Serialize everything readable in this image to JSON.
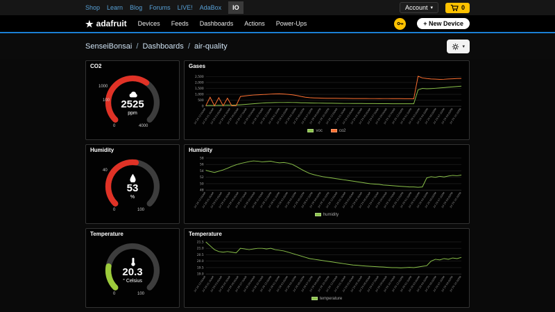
{
  "icons": {
    "star": "★",
    "caret_down": "▾"
  },
  "colors": {
    "accent_blue": "#1b7fd4",
    "brand_yellow": "#ffc200",
    "gauge_red": "#e03226",
    "gauge_green": "#9ccb3b",
    "line_green": "#8bc34a",
    "line_orange": "#ff7030",
    "track_gray": "#3d3d3d"
  },
  "topbar": {
    "links": [
      "Shop",
      "Learn",
      "Blog",
      "Forums",
      "LIVE!",
      "AdaBox"
    ],
    "io_badge": "IO",
    "account_label": "Account",
    "cart_count": "0"
  },
  "nav": {
    "brand": "adafruit",
    "items": [
      "Devices",
      "Feeds",
      "Dashboards",
      "Actions",
      "Power-Ups"
    ],
    "new_device_label": "+ New Device"
  },
  "breadcrumb": {
    "parts": [
      "SenseiBonsai",
      "Dashboards",
      "air-quality"
    ],
    "separator": "/"
  },
  "gauges": [
    {
      "key": "co2",
      "title": "CO2",
      "value": "2525",
      "unit": "ppm",
      "fraction": 0.63,
      "color": "#e03226",
      "track_color": "#3d3d3d",
      "icon": "cloud-icon",
      "shape": "cloud",
      "scale_labels": [
        {
          "text": "1000",
          "x": -3,
          "y": 20
        },
        {
          "text": "100",
          "x": 3,
          "y": 40
        },
        {
          "text": "0",
          "x": 18,
          "y": 77
        },
        {
          "text": "4000",
          "x": 55,
          "y": 77
        }
      ]
    },
    {
      "key": "humidity",
      "title": "Humidity",
      "value": "53",
      "unit": "%",
      "fraction": 0.53,
      "color": "#e03226",
      "track_color": "#3d3d3d",
      "icon": "droplet-icon",
      "shape": "drop",
      "scale_labels": [
        {
          "text": "40",
          "x": 3,
          "y": 20
        },
        {
          "text": "0",
          "x": 18,
          "y": 77
        },
        {
          "text": "100",
          "x": 53,
          "y": 77
        }
      ]
    },
    {
      "key": "temperature",
      "title": "Temperature",
      "value": "20.3",
      "unit": "° Celsius",
      "fraction": 0.203,
      "color": "#9ccb3b",
      "track_color": "#3d3d3d",
      "icon": "thermometer-icon",
      "shape": "therm",
      "scale_labels": [
        {
          "text": "0",
          "x": 18,
          "y": 77
        },
        {
          "text": "100",
          "x": 53,
          "y": 77
        }
      ]
    }
  ],
  "chart_data": {
    "x_ticks": [
      "Jul 28 12:00AM",
      "Jul 28 01:30AM",
      "Jul 28 03:00AM",
      "Jul 28 04:30AM",
      "Jul 28 06:00AM",
      "Jul 28 07:30AM",
      "Jul 28 09:00AM",
      "Jul 28 10:30AM",
      "Jul 28 12:00PM",
      "Jul 28 01:30PM",
      "Jul 28 03:00PM",
      "Jul 28 04:30PM",
      "Jul 28 06:00PM",
      "Jul 28 07:30PM",
      "Jul 28 09:00PM",
      "Jul 28 10:30PM",
      "Jul 29 12:00AM",
      "Jul 29 01:30AM",
      "Jul 29 03:00AM",
      "Jul 29 04:30AM",
      "Jul 29 06:00AM",
      "Jul 29 07:30AM",
      "Jul 29 09:00AM",
      "Jul 29 10:30AM",
      "Jul 29 12:00PM",
      "Jul 29 01:30PM",
      "Jul 29 03:00PM",
      "Jul 29 04:30PM",
      "Jul 29 06:00PM",
      "Jul 29 07:30PM",
      "Jul 29 09:00PM",
      "Jul 29 10:30PM"
    ],
    "charts": [
      {
        "key": "gases",
        "title": "Gases",
        "type": "line",
        "ylim": [
          0,
          2700
        ],
        "grid": true,
        "legend_position": "bottom",
        "yticks": [
          {
            "v": 0,
            "label": "0"
          },
          {
            "v": 500,
            "label": "500"
          },
          {
            "v": 1000,
            "label": "1,000"
          },
          {
            "v": 1500,
            "label": "1,500"
          },
          {
            "v": 2000,
            "label": "2,000"
          },
          {
            "v": 2500,
            "label": "2,500"
          }
        ],
        "series": [
          {
            "name": "voc",
            "color": "#8bc34a",
            "values": [
              50,
              70,
              60,
              80,
              70,
              90,
              85,
              95,
              120,
              150,
              180,
              210,
              240,
              265,
              285,
              300,
              310,
              315,
              318,
              320,
              315,
              310,
              295,
              285,
              275,
              268,
              262,
              258,
              254,
              250,
              246,
              242,
              238,
              235,
              232,
              230,
              228,
              226,
              224,
              222,
              220,
              218,
              216,
              214,
              212,
              210,
              208,
              206,
              205,
              1380,
              1500,
              1470,
              1490,
              1510,
              1540,
              1570,
              1600,
              1630,
              1660,
              1690
            ]
          },
          {
            "name": "co2",
            "color": "#ff7030",
            "values": [
              40,
              760,
              40,
              720,
              40,
              680,
              40,
              60,
              820,
              870,
              910,
              940,
              960,
              980,
              1000,
              1020,
              1040,
              1050,
              1030,
              1000,
              960,
              900,
              820,
              760,
              720,
              700,
              690,
              680,
              675,
              670,
              665,
              660,
              658,
              655,
              652,
              650,
              648,
              650,
              645,
              643,
              640,
              642,
              645,
              640,
              638,
              635,
              633,
              630,
              628,
              2520,
              2380,
              2330,
              2300,
              2280,
              2260,
              2270,
              2290,
              2310,
              2330,
              2340
            ]
          }
        ]
      },
      {
        "key": "humidity",
        "title": "Humidity",
        "type": "line",
        "ylim": [
          48,
          58
        ],
        "grid": true,
        "legend_position": "bottom",
        "yticks": [
          {
            "v": 48,
            "label": "48"
          },
          {
            "v": 50,
            "label": "50"
          },
          {
            "v": 52,
            "label": "52"
          },
          {
            "v": 54,
            "label": "54"
          },
          {
            "v": 56,
            "label": "56"
          },
          {
            "v": 58,
            "label": "58"
          }
        ],
        "series": [
          {
            "name": "humidity",
            "color": "#8bc34a",
            "values": [
              54.2,
              53.8,
              53.5,
              53.9,
              54.3,
              54.8,
              55.4,
              55.9,
              56.3,
              56.6,
              56.9,
              57.1,
              57.0,
              56.8,
              56.9,
              57.0,
              56.7,
              56.5,
              56.6,
              56.4,
              56.0,
              55.3,
              54.5,
              53.8,
              53.2,
              52.8,
              52.5,
              52.2,
              52.0,
              51.8,
              51.6,
              51.4,
              51.2,
              51.0,
              50.8,
              50.6,
              50.4,
              50.2,
              50.0,
              49.9,
              49.8,
              49.6,
              49.5,
              49.4,
              49.3,
              49.2,
              49.1,
              49.0,
              49.0,
              48.9,
              49.0,
              51.8,
              52.2,
              52.0,
              52.3,
              52.1,
              52.4,
              52.6,
              52.5,
              52.7
            ]
          }
        ]
      },
      {
        "key": "temperature",
        "title": "Temperature",
        "type": "line",
        "ylim": [
          19.0,
          21.5
        ],
        "grid": true,
        "legend_position": "bottom",
        "yticks": [
          {
            "v": 19.0,
            "label": "19.0"
          },
          {
            "v": 19.5,
            "label": "19.5"
          },
          {
            "v": 20.0,
            "label": "20.0"
          },
          {
            "v": 20.5,
            "label": "20.5"
          },
          {
            "v": 21.0,
            "label": "21.0"
          },
          {
            "v": 21.5,
            "label": "21.5"
          }
        ],
        "series": [
          {
            "name": "temperature",
            "color": "#8bc34a",
            "values": [
              21.5,
              21.2,
              20.9,
              20.75,
              20.7,
              20.75,
              20.7,
              20.65,
              21.0,
              20.95,
              20.9,
              20.95,
              21.0,
              21.0,
              20.95,
              21.0,
              20.9,
              20.85,
              20.8,
              20.7,
              20.6,
              20.5,
              20.4,
              20.3,
              20.2,
              20.15,
              20.1,
              20.05,
              20.0,
              19.95,
              19.9,
              19.85,
              19.8,
              19.75,
              19.7,
              19.68,
              19.65,
              19.62,
              19.6,
              19.58,
              19.56,
              19.54,
              19.52,
              19.5,
              19.5,
              19.48,
              19.5,
              19.52,
              19.5,
              19.55,
              19.6,
              19.65,
              20.0,
              20.15,
              20.1,
              20.2,
              20.15,
              20.25,
              20.2,
              20.3
            ]
          }
        ]
      }
    ]
  }
}
